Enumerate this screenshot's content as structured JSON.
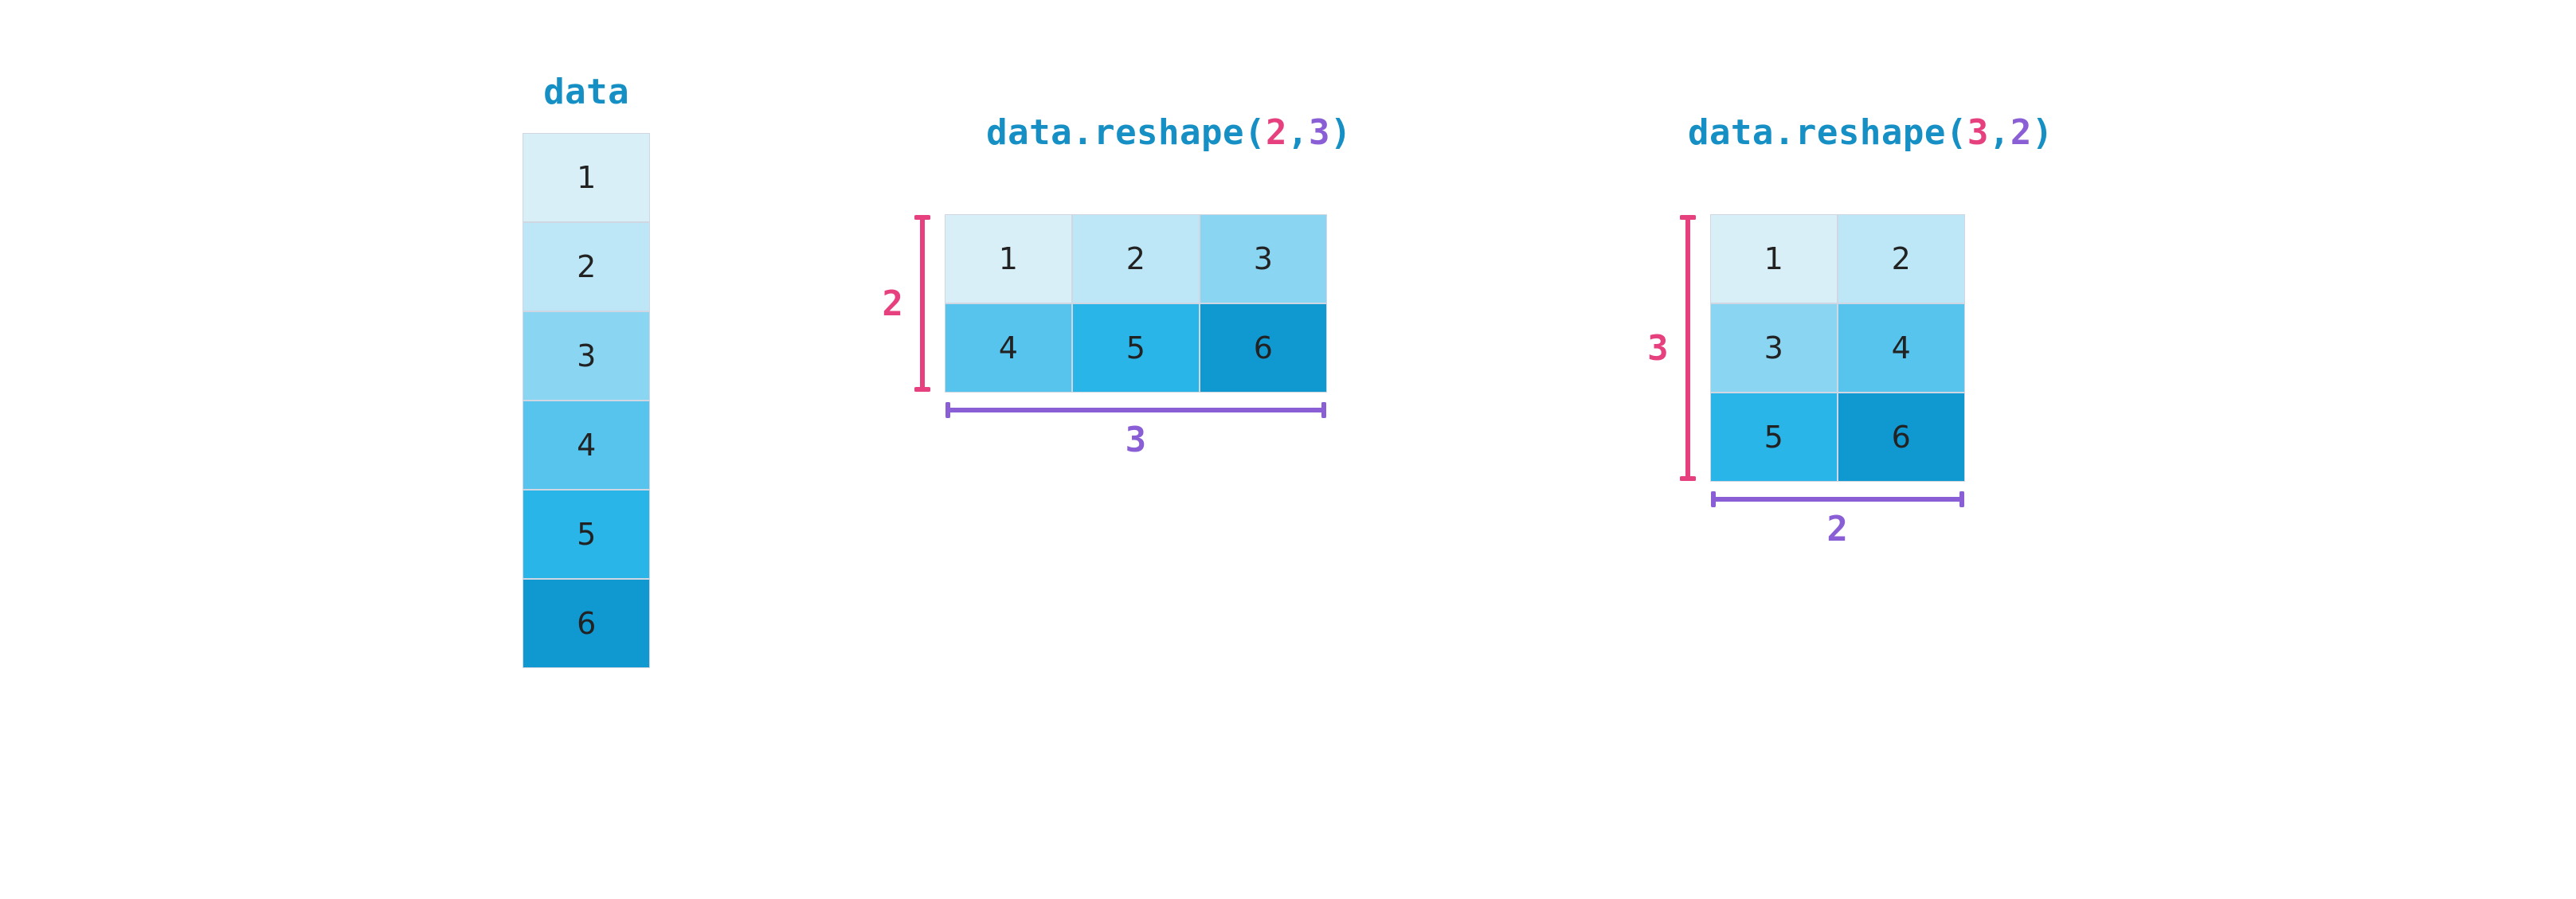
{
  "panel1": {
    "title": "data",
    "cells": [
      "1",
      "2",
      "3",
      "4",
      "5",
      "6"
    ]
  },
  "panel2": {
    "title_prefix": "data.reshape(",
    "title_arg1": "2",
    "title_sep": ",",
    "title_arg2": "3",
    "title_suffix": ")",
    "rows_label": "2",
    "cols_label": "3",
    "cells": [
      "1",
      "2",
      "3",
      "4",
      "5",
      "6"
    ]
  },
  "panel3": {
    "title_prefix": "data.reshape(",
    "title_arg1": "3",
    "title_sep": ",",
    "title_arg2": "2",
    "title_suffix": ")",
    "rows_label": "3",
    "cols_label": "2",
    "cells": [
      "1",
      "2",
      "3",
      "4",
      "5",
      "6"
    ]
  },
  "chart_data": [
    {
      "type": "table",
      "title": "data",
      "shape": [
        6,
        1
      ],
      "values": [
        [
          1
        ],
        [
          2
        ],
        [
          3
        ],
        [
          4
        ],
        [
          5
        ],
        [
          6
        ]
      ]
    },
    {
      "type": "table",
      "title": "data.reshape(2,3)",
      "shape": [
        2,
        3
      ],
      "values": [
        [
          1,
          2,
          3
        ],
        [
          4,
          5,
          6
        ]
      ]
    },
    {
      "type": "table",
      "title": "data.reshape(3,2)",
      "shape": [
        3,
        2
      ],
      "values": [
        [
          1,
          2
        ],
        [
          3,
          4
        ],
        [
          5,
          6
        ]
      ]
    }
  ]
}
